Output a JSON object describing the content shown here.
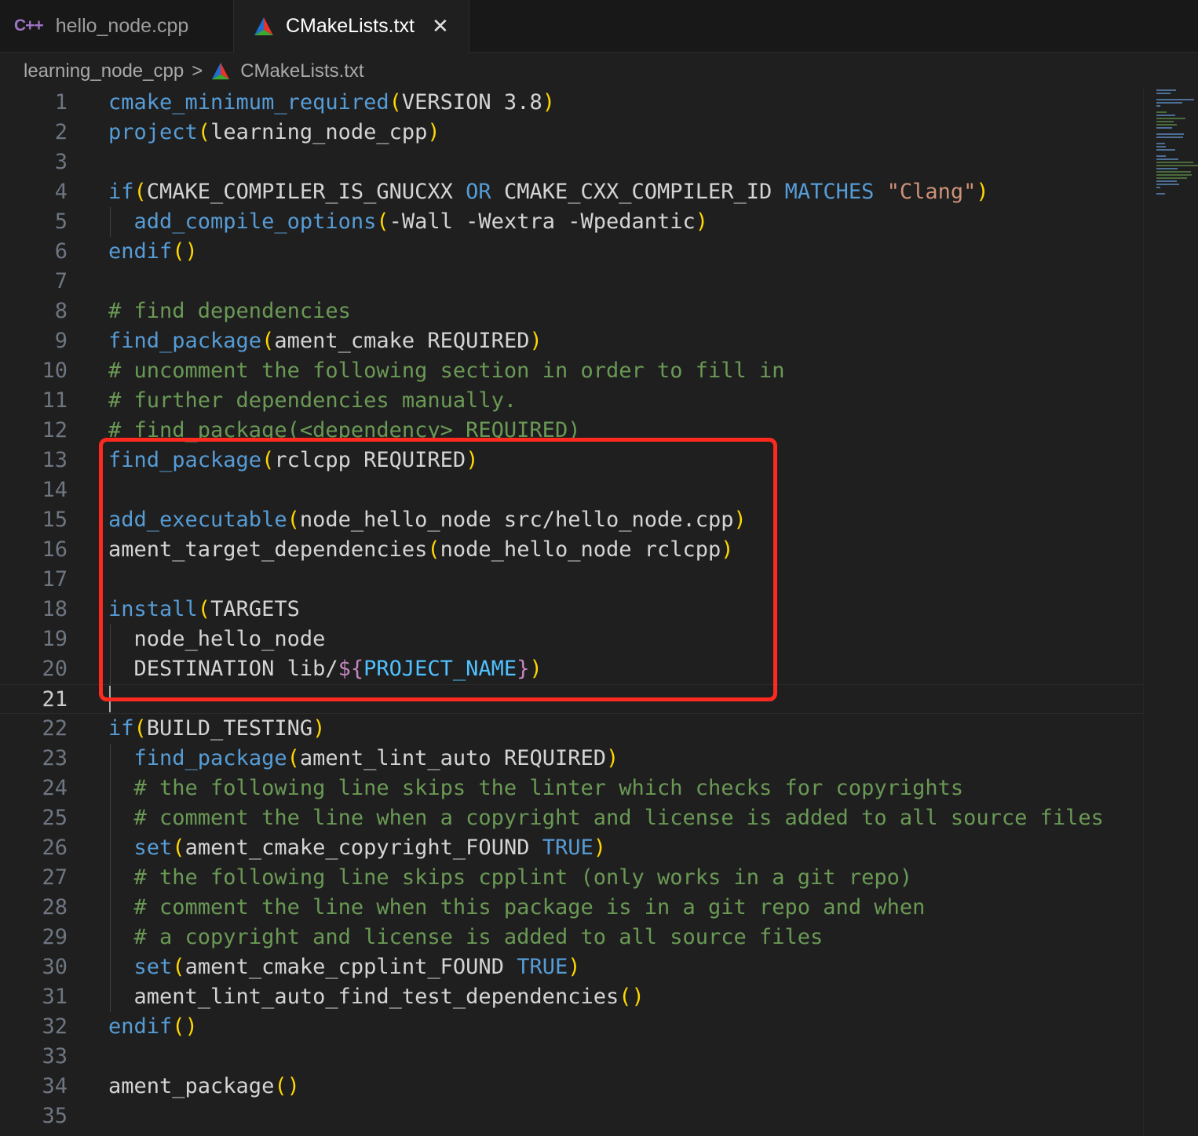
{
  "tabs": [
    {
      "label": "hello_node.cpp",
      "icon": "cpp-icon",
      "icon_text": "C++",
      "active": false
    },
    {
      "label": "CMakeLists.txt",
      "icon": "cmake-icon",
      "active": true,
      "close": "✕"
    }
  ],
  "breadcrumb": {
    "folder": "learning_node_cpp",
    "separator": ">",
    "file": "CMakeLists.txt"
  },
  "editor": {
    "current_line": 21,
    "highlight_lines": [
      13,
      20
    ],
    "lines": [
      {
        "n": "1",
        "tokens": [
          [
            "f",
            "cmake_minimum_required"
          ],
          [
            "p",
            "("
          ],
          [
            "t",
            "VERSION 3.8"
          ],
          [
            "p",
            ")"
          ]
        ]
      },
      {
        "n": "2",
        "tokens": [
          [
            "f",
            "project"
          ],
          [
            "p",
            "("
          ],
          [
            "t",
            "learning_node_cpp"
          ],
          [
            "p",
            ")"
          ]
        ]
      },
      {
        "n": "3",
        "tokens": []
      },
      {
        "n": "4",
        "tokens": [
          [
            "f",
            "if"
          ],
          [
            "p",
            "("
          ],
          [
            "t",
            "CMAKE_COMPILER_IS_GNUCXX "
          ],
          [
            "k",
            "OR"
          ],
          [
            "t",
            " CMAKE_CXX_COMPILER_ID "
          ],
          [
            "k",
            "MATCHES"
          ],
          [
            "t",
            " "
          ],
          [
            "s",
            "\"Clang\""
          ],
          [
            "p",
            ")"
          ]
        ]
      },
      {
        "n": "5",
        "tokens": [
          [
            "t",
            "  "
          ],
          [
            "f",
            "add_compile_options"
          ],
          [
            "p",
            "("
          ],
          [
            "t",
            "-Wall -Wextra -Wpedantic"
          ],
          [
            "p",
            ")"
          ]
        ]
      },
      {
        "n": "6",
        "tokens": [
          [
            "f",
            "endif"
          ],
          [
            "p",
            "()"
          ]
        ]
      },
      {
        "n": "7",
        "tokens": []
      },
      {
        "n": "8",
        "tokens": [
          [
            "c",
            "# find dependencies"
          ]
        ]
      },
      {
        "n": "9",
        "tokens": [
          [
            "f",
            "find_package"
          ],
          [
            "p",
            "("
          ],
          [
            "t",
            "ament_cmake REQUIRED"
          ],
          [
            "p",
            ")"
          ]
        ]
      },
      {
        "n": "10",
        "tokens": [
          [
            "c",
            "# uncomment the following section in order to fill in"
          ]
        ]
      },
      {
        "n": "11",
        "tokens": [
          [
            "c",
            "# further dependencies manually."
          ]
        ]
      },
      {
        "n": "12",
        "tokens": [
          [
            "c",
            "# find_package(<dependency> REQUIRED)"
          ]
        ]
      },
      {
        "n": "13",
        "tokens": [
          [
            "f",
            "find_package"
          ],
          [
            "p",
            "("
          ],
          [
            "t",
            "rclcpp REQUIRED"
          ],
          [
            "p",
            ")"
          ]
        ]
      },
      {
        "n": "14",
        "tokens": []
      },
      {
        "n": "15",
        "tokens": [
          [
            "f",
            "add_executable"
          ],
          [
            "p",
            "("
          ],
          [
            "t",
            "node_hello_node src/hello_node.cpp"
          ],
          [
            "p",
            ")"
          ]
        ]
      },
      {
        "n": "16",
        "tokens": [
          [
            "t",
            "ament_target_dependencies"
          ],
          [
            "p",
            "("
          ],
          [
            "t",
            "node_hello_node rclcpp"
          ],
          [
            "p",
            ")"
          ]
        ]
      },
      {
        "n": "17",
        "tokens": []
      },
      {
        "n": "18",
        "tokens": [
          [
            "f",
            "install"
          ],
          [
            "p",
            "("
          ],
          [
            "t",
            "TARGETS"
          ]
        ]
      },
      {
        "n": "19",
        "tokens": [
          [
            "t",
            "  node_hello_node"
          ]
        ]
      },
      {
        "n": "20",
        "tokens": [
          [
            "t",
            "  DESTINATION lib/"
          ],
          [
            "d",
            "${"
          ],
          [
            "v",
            "PROJECT_NAME"
          ],
          [
            "d",
            "}"
          ],
          [
            "p",
            ")"
          ]
        ]
      },
      {
        "n": "21",
        "tokens": []
      },
      {
        "n": "22",
        "tokens": [
          [
            "f",
            "if"
          ],
          [
            "p",
            "("
          ],
          [
            "t",
            "BUILD_TESTING"
          ],
          [
            "p",
            ")"
          ]
        ]
      },
      {
        "n": "23",
        "tokens": [
          [
            "t",
            "  "
          ],
          [
            "f",
            "find_package"
          ],
          [
            "p",
            "("
          ],
          [
            "t",
            "ament_lint_auto REQUIRED"
          ],
          [
            "p",
            ")"
          ]
        ]
      },
      {
        "n": "24",
        "tokens": [
          [
            "t",
            "  "
          ],
          [
            "c",
            "# the following line skips the linter which checks for copyrights"
          ]
        ]
      },
      {
        "n": "25",
        "tokens": [
          [
            "t",
            "  "
          ],
          [
            "c",
            "# comment the line when a copyright and license is added to all source files"
          ]
        ]
      },
      {
        "n": "26",
        "tokens": [
          [
            "t",
            "  "
          ],
          [
            "f",
            "set"
          ],
          [
            "p",
            "("
          ],
          [
            "t",
            "ament_cmake_copyright_FOUND "
          ],
          [
            "k",
            "TRUE"
          ],
          [
            "p",
            ")"
          ]
        ]
      },
      {
        "n": "27",
        "tokens": [
          [
            "t",
            "  "
          ],
          [
            "c",
            "# the following line skips cpplint (only works in a git repo)"
          ]
        ]
      },
      {
        "n": "28",
        "tokens": [
          [
            "t",
            "  "
          ],
          [
            "c",
            "# comment the line when this package is in a git repo and when"
          ]
        ]
      },
      {
        "n": "29",
        "tokens": [
          [
            "t",
            "  "
          ],
          [
            "c",
            "# a copyright and license is added to all source files"
          ]
        ]
      },
      {
        "n": "30",
        "tokens": [
          [
            "t",
            "  "
          ],
          [
            "f",
            "set"
          ],
          [
            "p",
            "("
          ],
          [
            "t",
            "ament_cmake_cpplint_FOUND "
          ],
          [
            "k",
            "TRUE"
          ],
          [
            "p",
            ")"
          ]
        ]
      },
      {
        "n": "31",
        "tokens": [
          [
            "t",
            "  ament_lint_auto_find_test_dependencies"
          ],
          [
            "p",
            "()"
          ]
        ]
      },
      {
        "n": "32",
        "tokens": [
          [
            "f",
            "endif"
          ],
          [
            "p",
            "()"
          ]
        ]
      },
      {
        "n": "33",
        "tokens": []
      },
      {
        "n": "34",
        "tokens": [
          [
            "t",
            "ament_package"
          ],
          [
            "p",
            "()"
          ]
        ]
      },
      {
        "n": "35",
        "tokens": []
      }
    ]
  },
  "colors": {
    "function": "#569cd6",
    "paren": "#ffd700",
    "comment": "#6a9955",
    "string": "#ce9178",
    "highlight_box": "#ff2a1f"
  }
}
